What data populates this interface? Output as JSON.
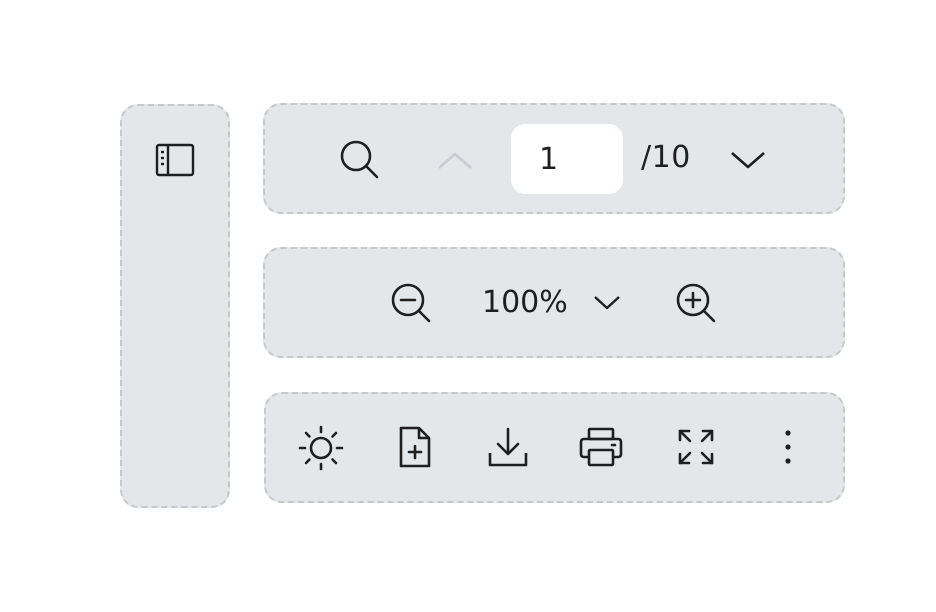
{
  "toolbar": {
    "sidebar_toggle_icon": "sidebar-panel-icon",
    "navigation": {
      "search_icon": "search-icon",
      "prev_page_icon": "chevron-up-icon",
      "current_page": "1",
      "total_pages_label": "/10",
      "next_page_icon": "chevron-down-icon"
    },
    "zoom": {
      "zoom_out_icon": "zoom-out-icon",
      "zoom_level": "100%",
      "zoom_dropdown_icon": "chevron-down-icon",
      "zoom_in_icon": "zoom-in-icon"
    },
    "actions": [
      {
        "name": "theme",
        "icon": "sun-icon"
      },
      {
        "name": "add-document",
        "icon": "file-plus-icon"
      },
      {
        "name": "download",
        "icon": "download-icon"
      },
      {
        "name": "print",
        "icon": "printer-icon"
      },
      {
        "name": "fullscreen",
        "icon": "expand-icon"
      },
      {
        "name": "more",
        "icon": "more-vertical-icon"
      }
    ]
  },
  "colors": {
    "panel_bg": "#e4e7ea",
    "panel_border": "#c6c8cb",
    "icon": "#1f1f1f",
    "icon_disabled": "#c9ccd0",
    "input_bg": "#ffffff"
  }
}
